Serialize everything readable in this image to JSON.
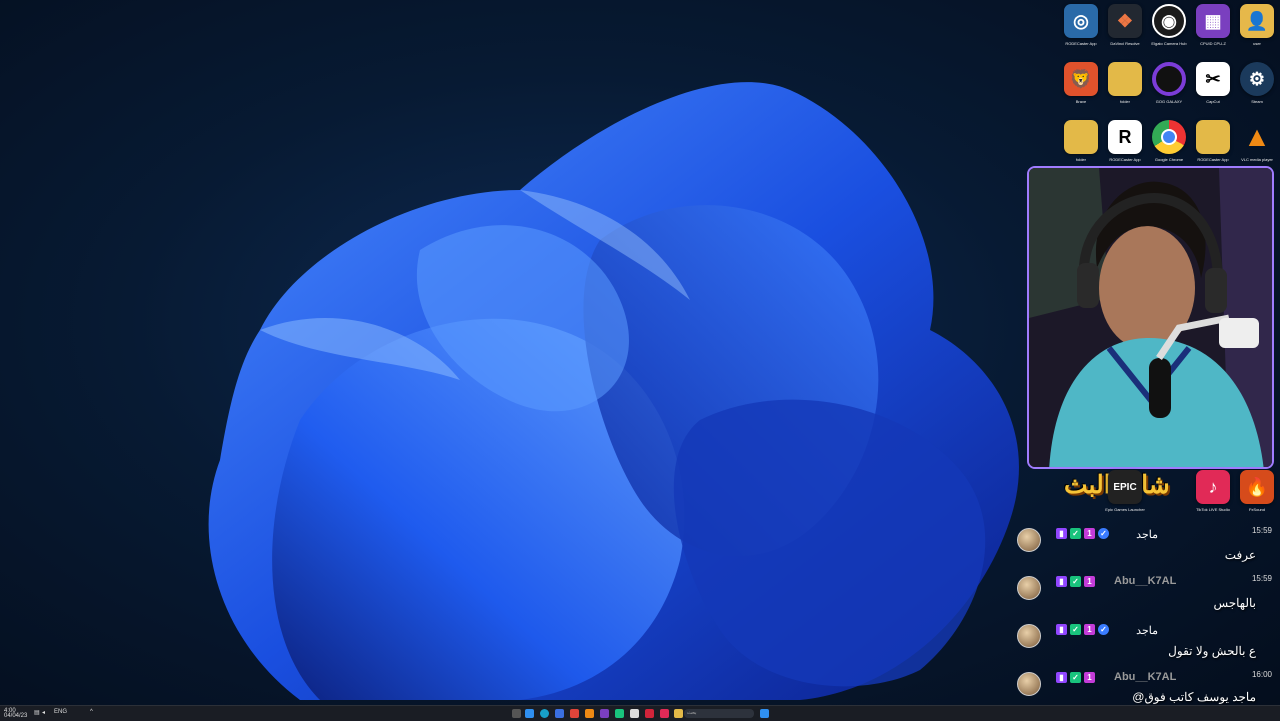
{
  "desktop": {
    "icons_row1": [
      {
        "label": "RODECaster App",
        "icon": "rode-icon",
        "color": "#2a6aa8"
      },
      {
        "label": "DaVinci Resolve",
        "icon": "davinci-icon",
        "color": "#222831"
      },
      {
        "label": "Elgato Camera Hub",
        "icon": "camera-icon",
        "color": "#1b1b1b"
      },
      {
        "label": "CPUID CPU-Z",
        "icon": "cpuz-icon",
        "color": "#7a3fbf"
      },
      {
        "label": "user",
        "icon": "user-folder-icon",
        "color": "#e6b84a"
      }
    ],
    "icons_row2": [
      {
        "label": "Brave",
        "icon": "brave-icon",
        "color": "#e0522c"
      },
      {
        "label": "folder",
        "icon": "folder-icon",
        "color": "#e3b948"
      },
      {
        "label": "GOG GALAXY",
        "icon": "gog-icon",
        "color": "#5b2ca8"
      },
      {
        "label": "CapCut",
        "icon": "capcut-icon",
        "color": "#ffffff"
      },
      {
        "label": "Steam",
        "icon": "steam-icon",
        "color": "#1b3a5c"
      }
    ],
    "icons_row3": [
      {
        "label": "folder",
        "icon": "folder-icon",
        "color": "#e3b948"
      },
      {
        "label": "RODECaster App",
        "icon": "rode-app-icon",
        "color": "#ffffff"
      },
      {
        "label": "Google Chrome",
        "icon": "chrome-icon",
        "color": "#ffffff"
      },
      {
        "label": "RODECaster App",
        "icon": "folder-icon",
        "color": "#e3b948"
      },
      {
        "label": "VLC media player",
        "icon": "vlc-icon",
        "color": "#f08a14"
      }
    ],
    "icons_row4": [
      {
        "label": "Epic Games Launcher",
        "icon": "epic-icon",
        "color": "#222222"
      },
      {
        "label": "TikTok LIVE Studio",
        "icon": "tiktok-icon",
        "color": "#e12a57"
      },
      {
        "label": "FxSound",
        "icon": "fxsound-icon",
        "color": "#d64b1b"
      }
    ]
  },
  "overlay": {
    "title": "شات البث"
  },
  "chat": [
    {
      "name": "ماجد",
      "username": "",
      "time": "15:59",
      "message": "عرفت"
    },
    {
      "name": "",
      "username": "Abu__K7AL",
      "time": "15:59",
      "message": "بالهاجس"
    },
    {
      "name": "ماجد",
      "username": "",
      "time": "",
      "message": "ع بالحش ولا تقول"
    },
    {
      "name": "",
      "username": "Abu__K7AL",
      "time": "16:00",
      "message": "@ماجد يوسف كاتب فوق"
    }
  ],
  "taskbar": {
    "lang": "ENG",
    "search_placeholder": "بحث",
    "clock_time": "4:00",
    "clock_date": "04/04/23"
  },
  "colors": {
    "accent_purple": "#a07cff",
    "twitch": "#9146ff",
    "overlay_gold": "#f6c437"
  }
}
